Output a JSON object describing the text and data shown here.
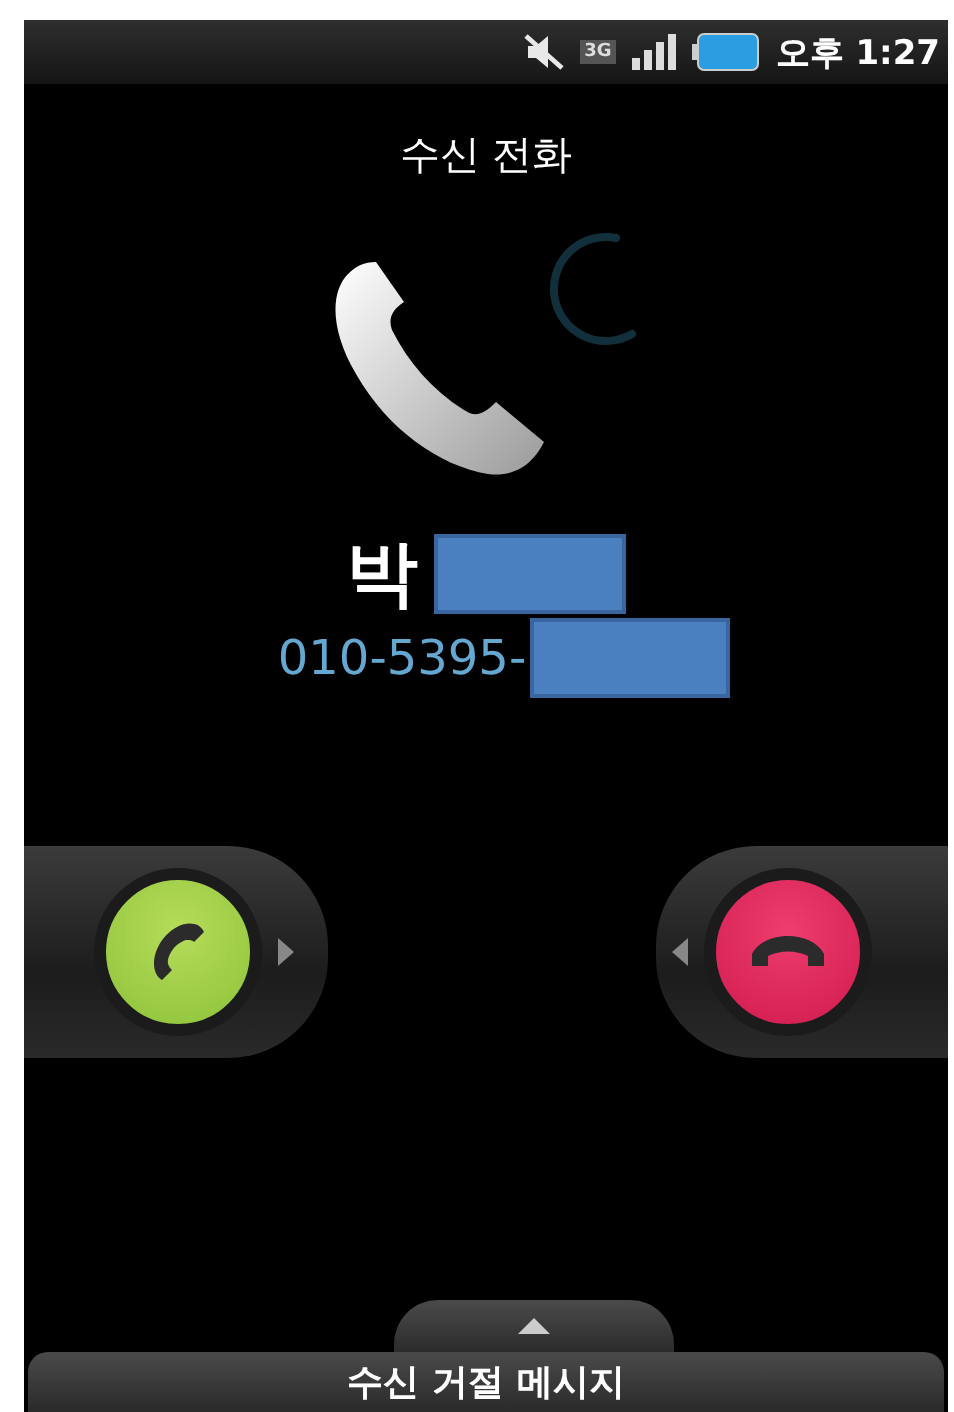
{
  "status_bar": {
    "time": "오후 1:27",
    "network": "3G",
    "muted": true
  },
  "title": "수신 전화",
  "caller": {
    "name": "박",
    "number": "010-5395-",
    "redacted": true
  },
  "bottom_tab": {
    "label": "수신 거절 메시지"
  }
}
